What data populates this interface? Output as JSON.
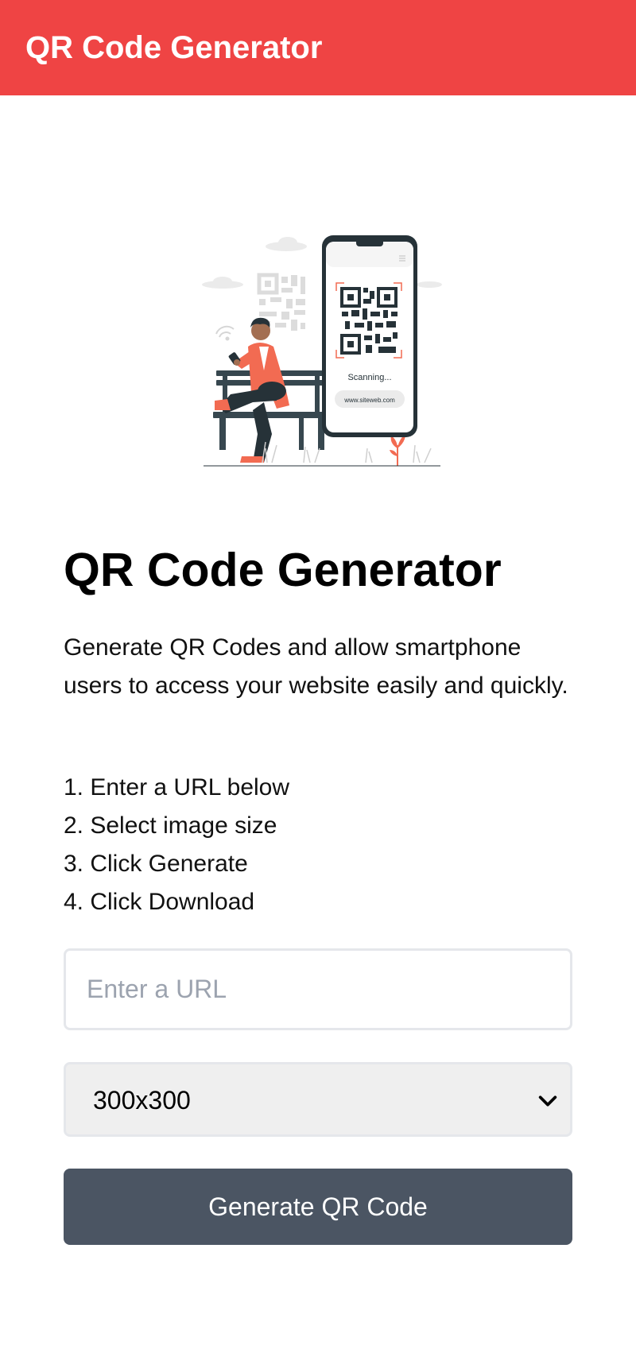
{
  "header": {
    "title": "QR Code Generator"
  },
  "illustration": {
    "scanning_text": "Scanning...",
    "url_text": "www.siteweb.com",
    "icon": "person-scanning-qr-illustration"
  },
  "main": {
    "title": "QR Code Generator",
    "description": "Generate QR Codes and allow smartphone users to access your website easily and quickly.",
    "steps": [
      "1. Enter a URL below",
      "2. Select image size",
      "3. Click Generate",
      "4. Click Download"
    ]
  },
  "form": {
    "url_placeholder": "Enter a URL",
    "url_value": "",
    "size_selected": "300x300",
    "generate_label": "Generate QR Code"
  },
  "colors": {
    "header": "#ef4444",
    "button": "#4b5563",
    "accent": "#f26b52"
  }
}
